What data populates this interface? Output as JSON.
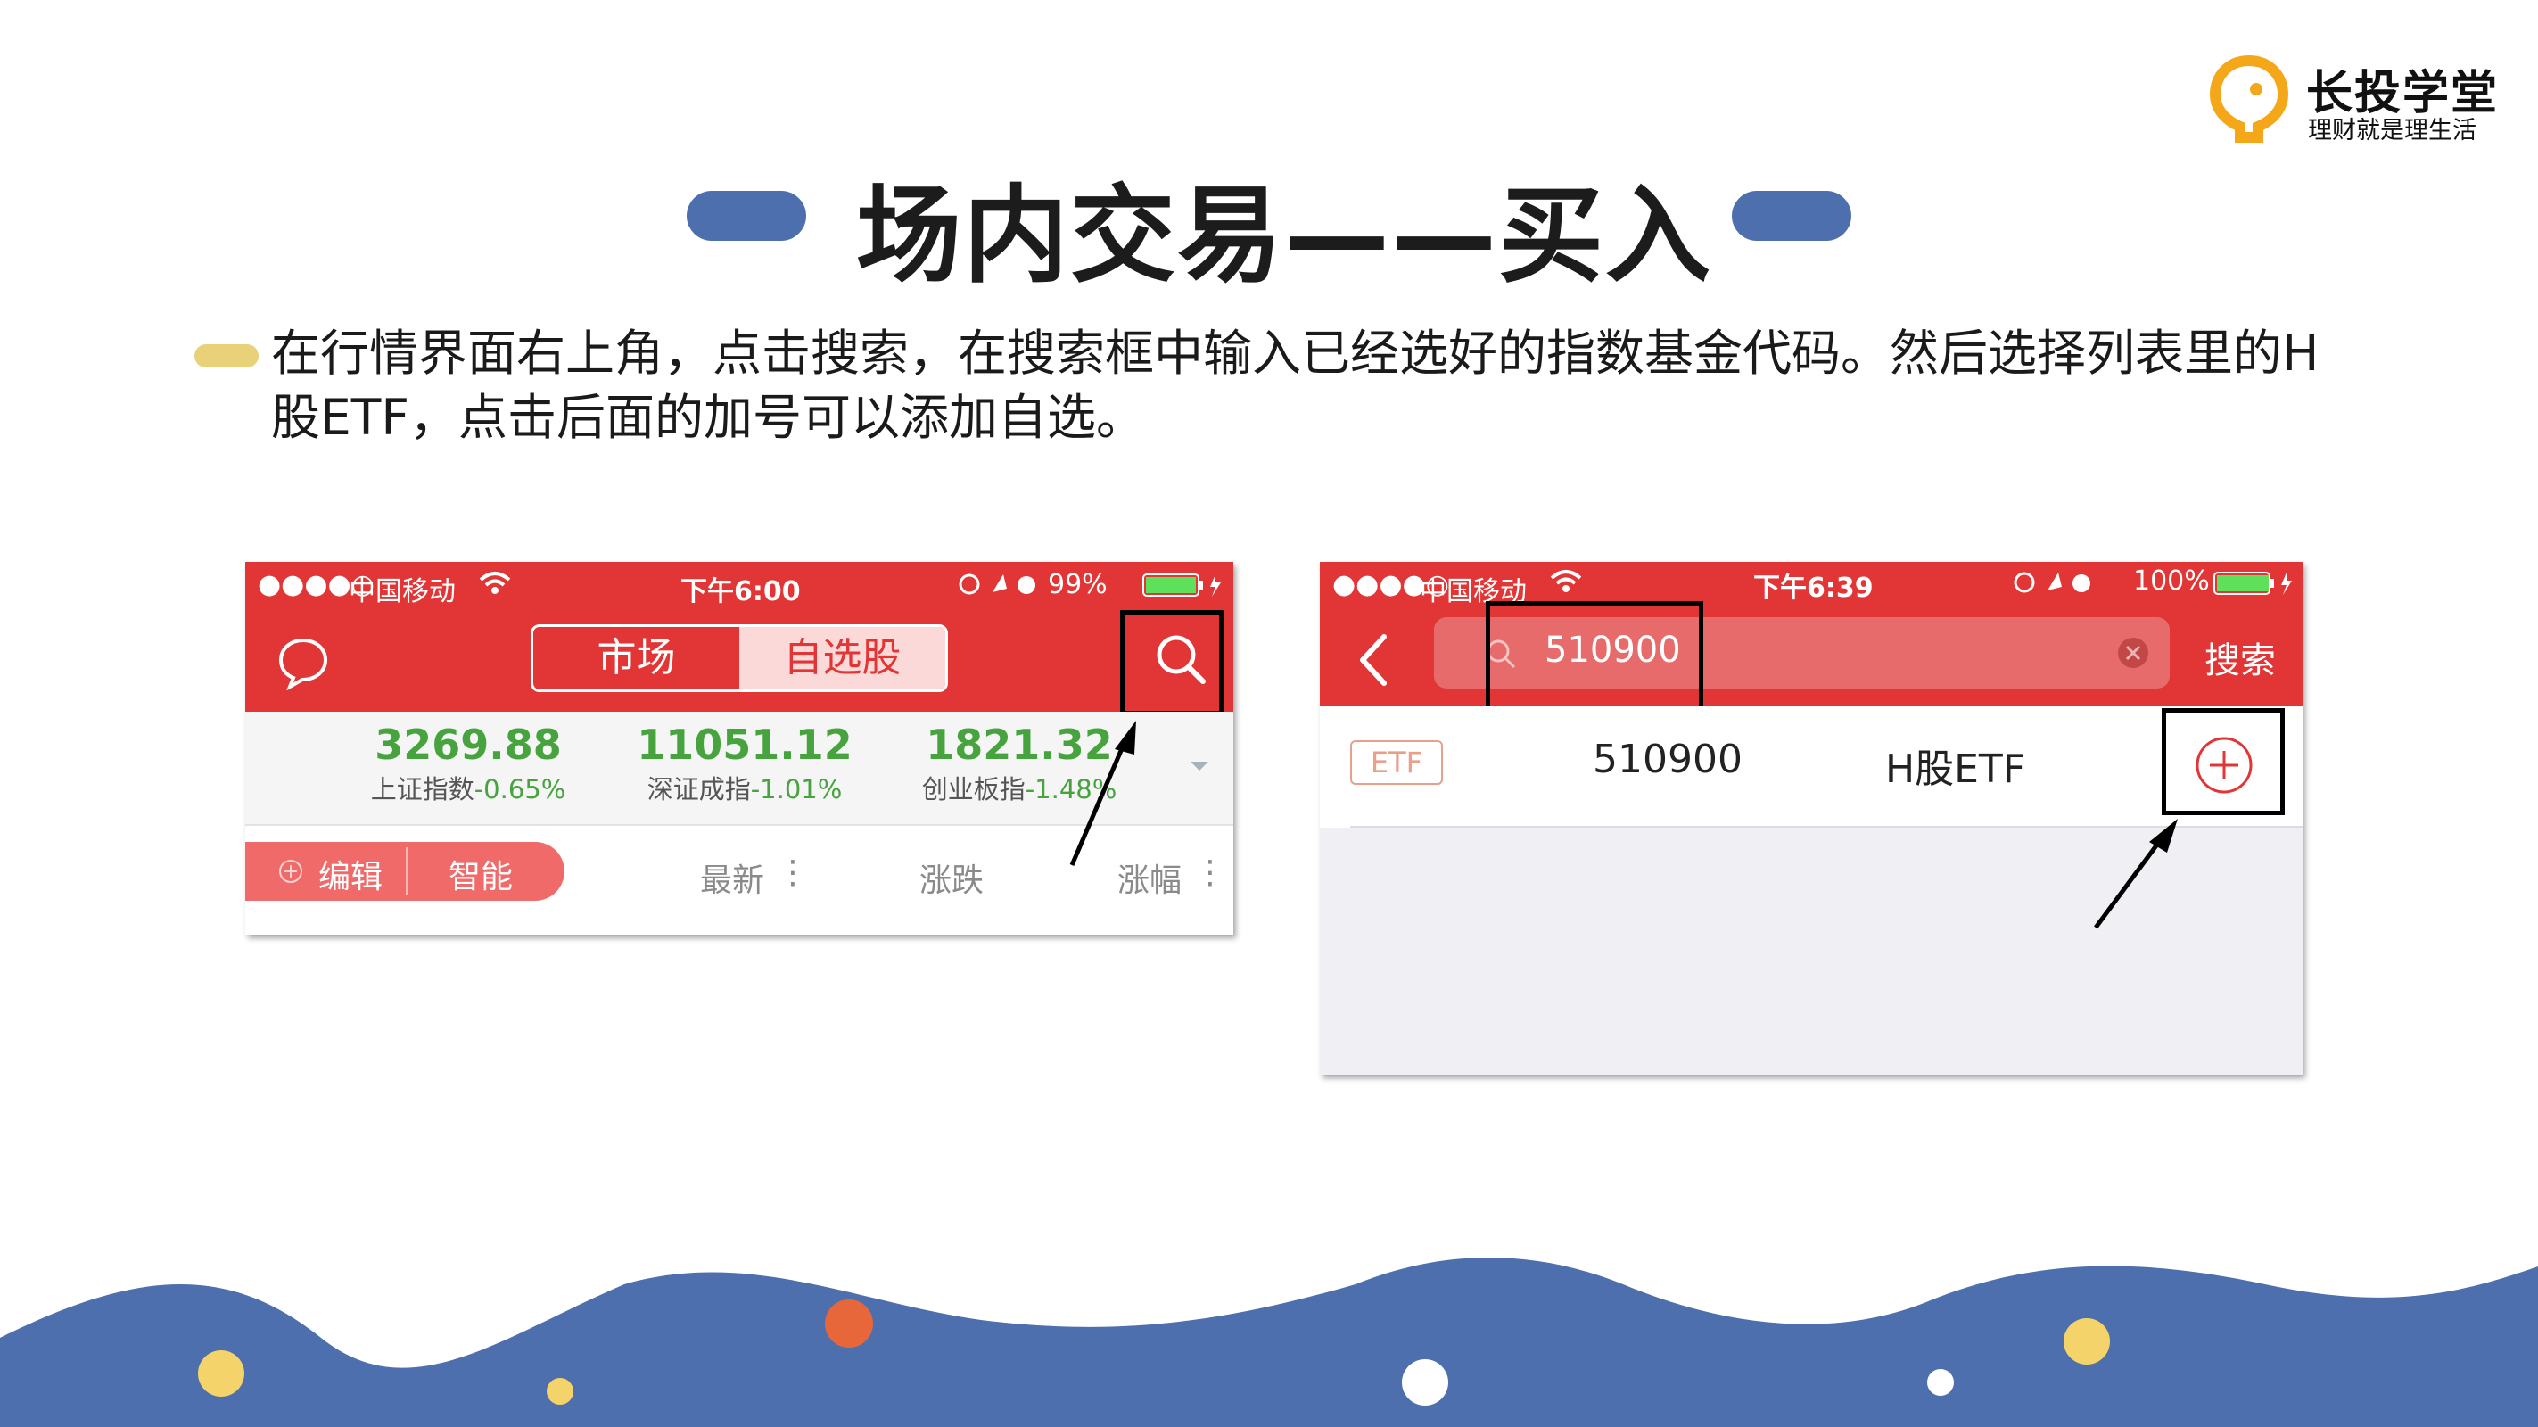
{
  "brand": {
    "name": "长投学堂",
    "slogan": "理财就是理生活",
    "logo_color": "#f5a71a"
  },
  "title": "场内交易——买入",
  "description": "在行情界面右上角，点击搜索，在搜索框中输入已经选好的指数基金代码。然后选择列表里的H股ETF，点击后面的加号可以添加自选。",
  "colors": {
    "accent_blue": "#4d6fad",
    "bullet_yellow": "#e8d179",
    "app_red": "#e23535",
    "up_green": "#46a33e"
  },
  "screenshot1": {
    "status": {
      "signal": "●●●●○",
      "carrier": "中国移动",
      "time": "下午6:00",
      "battery": "99%"
    },
    "icons": {
      "chat": "chat-bubble-icon",
      "search": "search-icon"
    },
    "tabs": [
      "市场",
      "自选股"
    ],
    "indices": [
      {
        "value": "3269.88",
        "name": "上证指数",
        "change": "-0.65%"
      },
      {
        "value": "11051.12",
        "name": "深证成指",
        "change": "-1.01%"
      },
      {
        "value": "1821.32",
        "name": "创业板指",
        "change": "-1.48%"
      }
    ],
    "toolbar": {
      "edit": "编辑",
      "smart": "智能",
      "columns": [
        "最新",
        "涨跌",
        "涨幅"
      ]
    }
  },
  "screenshot2": {
    "status": {
      "signal": "●●●●○",
      "carrier": "中国移动",
      "time": "下午6:39",
      "battery": "100%"
    },
    "search_query": "510900",
    "search_button": "搜索",
    "result": {
      "tag": "ETF",
      "code": "510900",
      "name": "H股ETF"
    }
  }
}
